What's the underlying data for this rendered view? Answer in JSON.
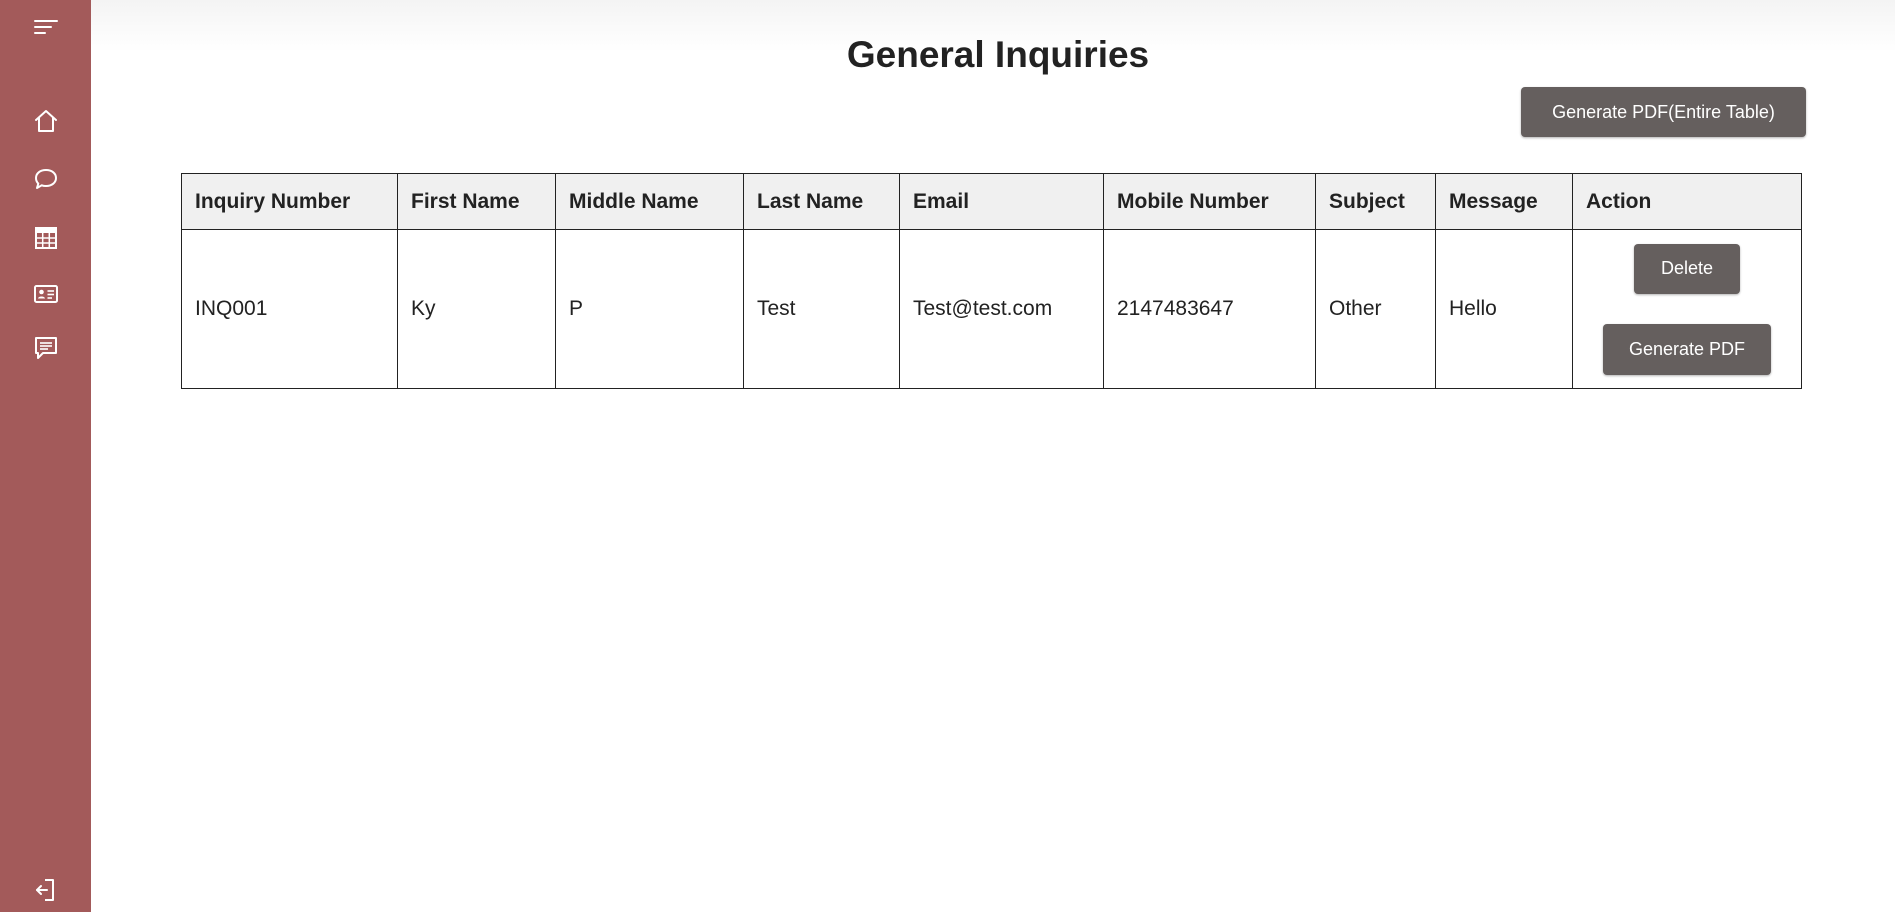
{
  "page": {
    "title": "General Inquiries",
    "generate_all_label": "Generate PDF(Entire Table)"
  },
  "sidebar": {
    "background": "#a35a5a",
    "icons": [
      "menu-icon",
      "home-icon",
      "chat-icon",
      "table-icon",
      "id-card-icon",
      "message-icon",
      "logout-icon"
    ]
  },
  "table": {
    "headers": [
      "Inquiry Number",
      "First Name",
      "Middle Name",
      "Last Name",
      "Email",
      "Mobile Number",
      "Subject",
      "Message",
      "Action"
    ],
    "rows": [
      {
        "inquiry_number": "INQ001",
        "first_name": "Ky",
        "middle_name": "P",
        "last_name": "Test",
        "email": "Test@test.com",
        "mobile_number": "2147483647",
        "subject": "Other",
        "message": "Hello",
        "delete_label": "Delete",
        "generate_label": "Generate PDF"
      }
    ]
  },
  "colors": {
    "button": "#655f5e",
    "header_bg": "#f0f0f0"
  }
}
